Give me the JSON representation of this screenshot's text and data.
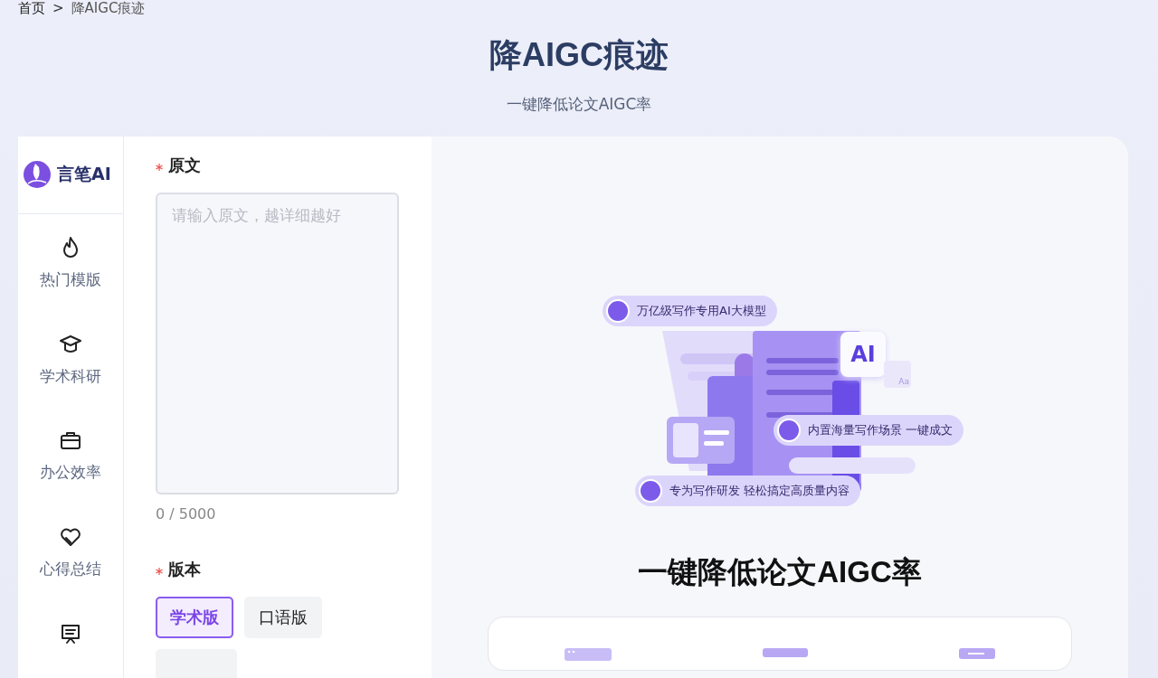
{
  "breadcrumb": {
    "items": [
      "首页",
      "降AIGC痕迹"
    ],
    "separator": ">"
  },
  "header": {
    "title": "降AIGC痕迹",
    "subtitle": "一键降低论文AIGC率"
  },
  "sidebar": {
    "logo": "言笔AI",
    "items": [
      {
        "kind": "flame",
        "label": "热门模版"
      },
      {
        "kind": "cap",
        "label": "学术科研"
      },
      {
        "kind": "briefcase",
        "label": "办公效率"
      },
      {
        "kind": "heart",
        "label": "心得总结"
      },
      {
        "kind": "board"
      }
    ]
  },
  "form": {
    "original": {
      "label": "原文",
      "required": true,
      "placeholder": "请输入原文，越详细越好",
      "count": "0 / 5000"
    },
    "version": {
      "label": "版本",
      "required": true,
      "options": [
        {
          "label": "学术版",
          "selected": true
        },
        {
          "label": "口语版",
          "selected": false
        }
      ]
    }
  },
  "preview": {
    "chips": [
      "万亿级写作专用AI大模型",
      "内置海量写作场景  一键成文",
      "专为写作研发  轻松搞定高质量内容"
    ],
    "badge": "AI",
    "small_badge": "Aa",
    "heading": "一键降低论文AIGC率"
  }
}
